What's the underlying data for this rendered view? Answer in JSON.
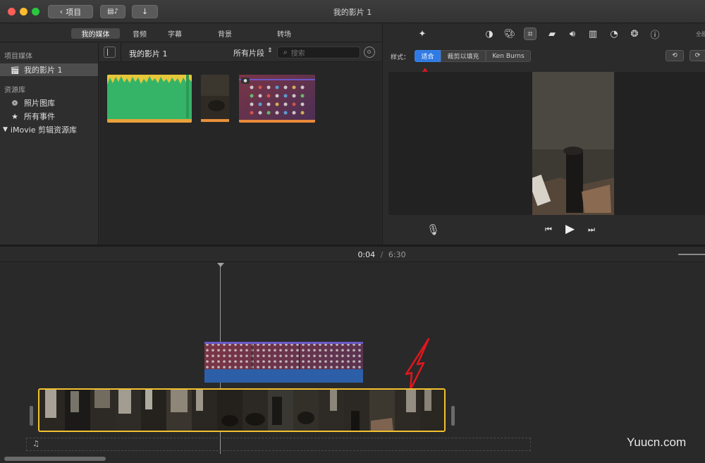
{
  "titlebar": {
    "back_label": "项目",
    "window_title": "我的影片 1"
  },
  "tabs": [
    {
      "label": "我的媒体"
    },
    {
      "label": "音频"
    },
    {
      "label": "字幕"
    },
    {
      "label": "背景"
    },
    {
      "label": "转场"
    }
  ],
  "sidebar": {
    "project_media_heading": "项目媒体",
    "project_item": "我的影片 1",
    "library_heading": "资源库",
    "library_items": [
      {
        "label": "照片图库",
        "icon": "flower-icon"
      },
      {
        "label": "所有事件",
        "icon": "star-icon"
      }
    ],
    "imovie_library": "iMovie 剪辑资源库"
  },
  "browser": {
    "title": "我的影片 1",
    "filter_label": "所有片段",
    "search_placeholder": "搜索"
  },
  "viewer": {
    "style_label": "样式：",
    "styles": [
      {
        "label": "适合",
        "active": true
      },
      {
        "label": "裁剪以填充",
        "active": false
      },
      {
        "label": "Ken Burns",
        "active": false
      }
    ],
    "partial_label": "全剧"
  },
  "timeline": {
    "current_time": "0:04",
    "separator": "/",
    "total_time": "6:30"
  },
  "watermark": "Yuucn.com",
  "colors": {
    "accent_blue": "#2f7ae5",
    "clip_border": "#f3c12f",
    "audio_green": "#3dbb6a",
    "arrow_red": "#e2161d"
  }
}
